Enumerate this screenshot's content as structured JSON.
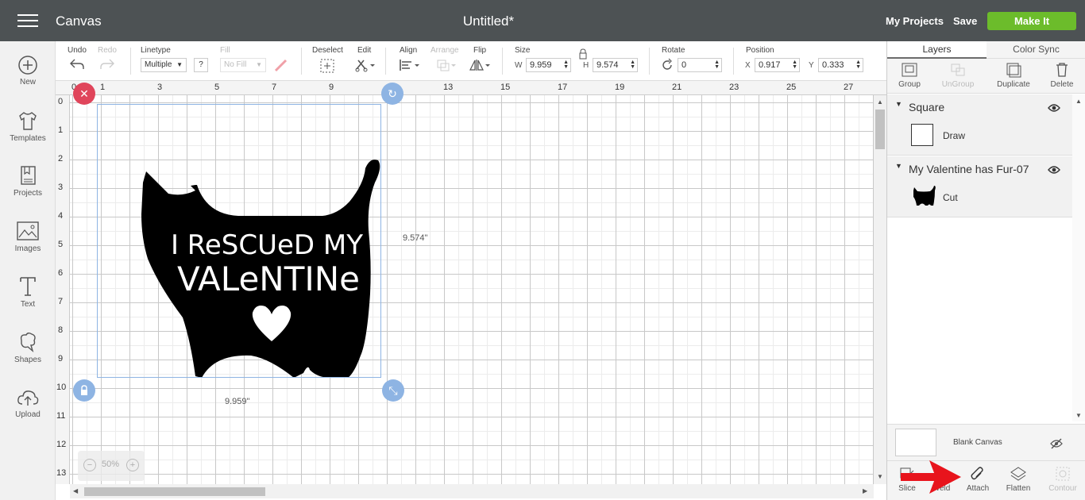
{
  "header": {
    "app_title": "Canvas",
    "doc_title": "Untitled*",
    "my_projects": "My Projects",
    "save": "Save",
    "make_it": "Make It"
  },
  "sidebar": {
    "items": [
      {
        "label": "New",
        "icon": "plus-circle-icon"
      },
      {
        "label": "Templates",
        "icon": "shirt-icon"
      },
      {
        "label": "Projects",
        "icon": "projects-icon"
      },
      {
        "label": "Images",
        "icon": "image-icon"
      },
      {
        "label": "Text",
        "icon": "text-icon"
      },
      {
        "label": "Shapes",
        "icon": "shapes-icon"
      },
      {
        "label": "Upload",
        "icon": "upload-icon"
      }
    ]
  },
  "toolbar": {
    "undo": "Undo",
    "redo": "Redo",
    "linetype_label": "Linetype",
    "linetype_value": "Multiple",
    "help": "?",
    "fill_label": "Fill",
    "fill_value": "No Fill",
    "deselect": "Deselect",
    "edit": "Edit",
    "align": "Align",
    "arrange": "Arrange",
    "flip": "Flip",
    "size_label": "Size",
    "w_label": "W",
    "w_value": "9.959",
    "h_label": "H",
    "h_value": "9.574",
    "rotate_label": "Rotate",
    "rotate_value": "0",
    "position_label": "Position",
    "x_label": "X",
    "x_value": "0.917",
    "y_label": "Y",
    "y_value": "0.333"
  },
  "canvas": {
    "ruler_top": [
      "0",
      "1",
      "3",
      "5",
      "7",
      "9",
      "11",
      "13",
      "15",
      "17",
      "19",
      "21",
      "23",
      "25",
      "27"
    ],
    "ruler_left": [
      "0",
      "1",
      "2",
      "3",
      "4",
      "5",
      "6",
      "7",
      "8",
      "9",
      "10",
      "11",
      "12",
      "13"
    ],
    "width_label": "9.959\"",
    "height_label": "9.574\"",
    "design_text_line1": "I ReSCUeD MY",
    "design_text_line2": "VALeNTINe",
    "zoom_minus": "−",
    "zoom_value": "50%",
    "zoom_plus": "+"
  },
  "layers_panel": {
    "tabs": [
      "Layers",
      "Color Sync"
    ],
    "tools": [
      {
        "label": "Group",
        "enabled": true
      },
      {
        "label": "UnGroup",
        "enabled": false
      },
      {
        "label": "Duplicate",
        "enabled": true
      },
      {
        "label": "Delete",
        "enabled": true
      }
    ],
    "groups": [
      {
        "name": "Square",
        "item_label": "Draw"
      },
      {
        "name": "My Valentine has Fur-07",
        "item_label": "Cut"
      }
    ],
    "blank_canvas": "Blank Canvas",
    "bottom_tools": [
      {
        "label": "Slice",
        "enabled": true
      },
      {
        "label": "Weld",
        "enabled": true
      },
      {
        "label": "Attach",
        "enabled": true
      },
      {
        "label": "Flatten",
        "enabled": true
      },
      {
        "label": "Contour",
        "enabled": false
      }
    ]
  },
  "colors": {
    "topbar": "#4d5254",
    "make_it": "#6cbc2b",
    "selection": "#8eb4e3",
    "handle_blue": "#8eb4e3",
    "handle_red": "#e0455b",
    "annotation_arrow": "#e8141c"
  }
}
